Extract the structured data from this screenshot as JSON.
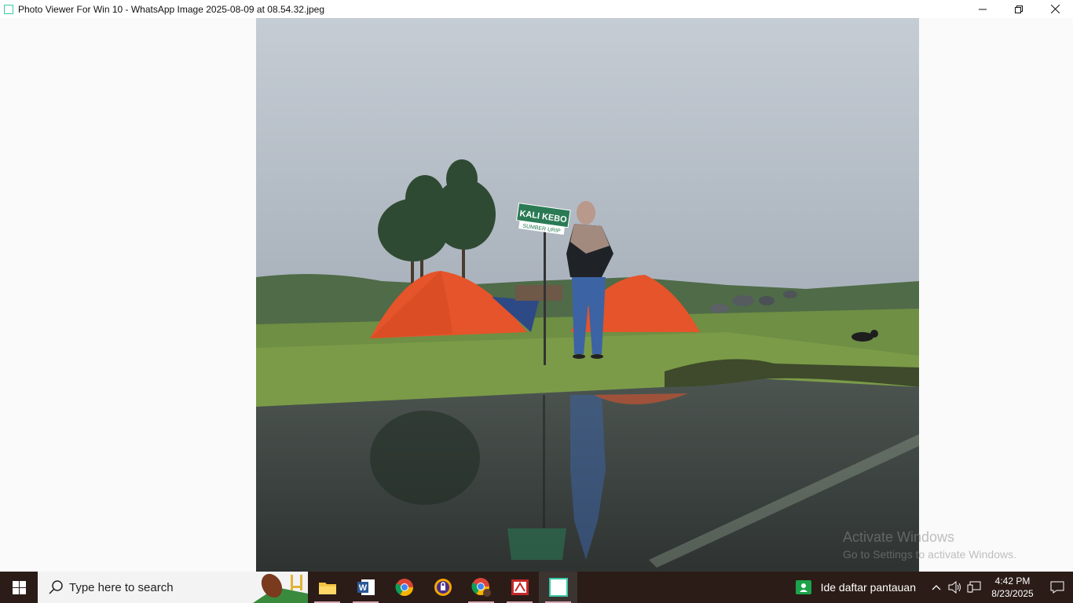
{
  "window": {
    "title": "Photo Viewer For Win 10 - WhatsApp Image 2025-08-09 at 08.54.32.jpeg",
    "controls": {
      "minimize": "—",
      "restore": "❐",
      "close": "✕"
    }
  },
  "photo": {
    "sign_title": "KALI KEBO",
    "sign_subtitle": "SUMBER URIP"
  },
  "watermark": {
    "line1": "Activate Windows",
    "line2": "Go to Settings to activate Windows."
  },
  "taskbar": {
    "search_placeholder": "Type here to search",
    "apps": [
      {
        "name": "file-explorer"
      },
      {
        "name": "word"
      },
      {
        "name": "chrome"
      },
      {
        "name": "vpn"
      },
      {
        "name": "chrome-profile"
      },
      {
        "name": "pdf"
      },
      {
        "name": "photo-viewer"
      }
    ],
    "news_text": "Ide daftar pantauan",
    "time": "4:42 PM",
    "date": "8/23/2025"
  },
  "colors": {
    "taskbar": "#2b1c17",
    "accent": "#3bc7a8"
  }
}
